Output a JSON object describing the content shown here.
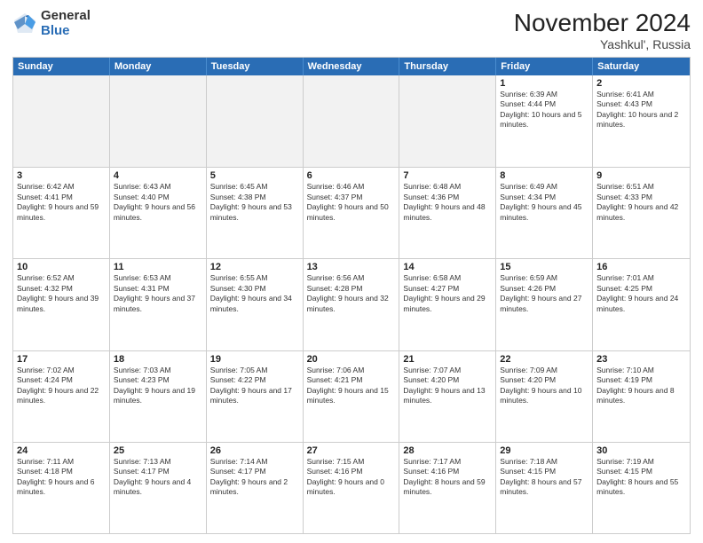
{
  "logo": {
    "general": "General",
    "blue": "Blue"
  },
  "title": {
    "month": "November 2024",
    "location": "Yashkul', Russia"
  },
  "header_days": [
    "Sunday",
    "Monday",
    "Tuesday",
    "Wednesday",
    "Thursday",
    "Friday",
    "Saturday"
  ],
  "weeks": [
    [
      {
        "day": "",
        "info": ""
      },
      {
        "day": "",
        "info": ""
      },
      {
        "day": "",
        "info": ""
      },
      {
        "day": "",
        "info": ""
      },
      {
        "day": "",
        "info": ""
      },
      {
        "day": "1",
        "info": "Sunrise: 6:39 AM\nSunset: 4:44 PM\nDaylight: 10 hours and 5 minutes."
      },
      {
        "day": "2",
        "info": "Sunrise: 6:41 AM\nSunset: 4:43 PM\nDaylight: 10 hours and 2 minutes."
      }
    ],
    [
      {
        "day": "3",
        "info": "Sunrise: 6:42 AM\nSunset: 4:41 PM\nDaylight: 9 hours and 59 minutes."
      },
      {
        "day": "4",
        "info": "Sunrise: 6:43 AM\nSunset: 4:40 PM\nDaylight: 9 hours and 56 minutes."
      },
      {
        "day": "5",
        "info": "Sunrise: 6:45 AM\nSunset: 4:38 PM\nDaylight: 9 hours and 53 minutes."
      },
      {
        "day": "6",
        "info": "Sunrise: 6:46 AM\nSunset: 4:37 PM\nDaylight: 9 hours and 50 minutes."
      },
      {
        "day": "7",
        "info": "Sunrise: 6:48 AM\nSunset: 4:36 PM\nDaylight: 9 hours and 48 minutes."
      },
      {
        "day": "8",
        "info": "Sunrise: 6:49 AM\nSunset: 4:34 PM\nDaylight: 9 hours and 45 minutes."
      },
      {
        "day": "9",
        "info": "Sunrise: 6:51 AM\nSunset: 4:33 PM\nDaylight: 9 hours and 42 minutes."
      }
    ],
    [
      {
        "day": "10",
        "info": "Sunrise: 6:52 AM\nSunset: 4:32 PM\nDaylight: 9 hours and 39 minutes."
      },
      {
        "day": "11",
        "info": "Sunrise: 6:53 AM\nSunset: 4:31 PM\nDaylight: 9 hours and 37 minutes."
      },
      {
        "day": "12",
        "info": "Sunrise: 6:55 AM\nSunset: 4:30 PM\nDaylight: 9 hours and 34 minutes."
      },
      {
        "day": "13",
        "info": "Sunrise: 6:56 AM\nSunset: 4:28 PM\nDaylight: 9 hours and 32 minutes."
      },
      {
        "day": "14",
        "info": "Sunrise: 6:58 AM\nSunset: 4:27 PM\nDaylight: 9 hours and 29 minutes."
      },
      {
        "day": "15",
        "info": "Sunrise: 6:59 AM\nSunset: 4:26 PM\nDaylight: 9 hours and 27 minutes."
      },
      {
        "day": "16",
        "info": "Sunrise: 7:01 AM\nSunset: 4:25 PM\nDaylight: 9 hours and 24 minutes."
      }
    ],
    [
      {
        "day": "17",
        "info": "Sunrise: 7:02 AM\nSunset: 4:24 PM\nDaylight: 9 hours and 22 minutes."
      },
      {
        "day": "18",
        "info": "Sunrise: 7:03 AM\nSunset: 4:23 PM\nDaylight: 9 hours and 19 minutes."
      },
      {
        "day": "19",
        "info": "Sunrise: 7:05 AM\nSunset: 4:22 PM\nDaylight: 9 hours and 17 minutes."
      },
      {
        "day": "20",
        "info": "Sunrise: 7:06 AM\nSunset: 4:21 PM\nDaylight: 9 hours and 15 minutes."
      },
      {
        "day": "21",
        "info": "Sunrise: 7:07 AM\nSunset: 4:20 PM\nDaylight: 9 hours and 13 minutes."
      },
      {
        "day": "22",
        "info": "Sunrise: 7:09 AM\nSunset: 4:20 PM\nDaylight: 9 hours and 10 minutes."
      },
      {
        "day": "23",
        "info": "Sunrise: 7:10 AM\nSunset: 4:19 PM\nDaylight: 9 hours and 8 minutes."
      }
    ],
    [
      {
        "day": "24",
        "info": "Sunrise: 7:11 AM\nSunset: 4:18 PM\nDaylight: 9 hours and 6 minutes."
      },
      {
        "day": "25",
        "info": "Sunrise: 7:13 AM\nSunset: 4:17 PM\nDaylight: 9 hours and 4 minutes."
      },
      {
        "day": "26",
        "info": "Sunrise: 7:14 AM\nSunset: 4:17 PM\nDaylight: 9 hours and 2 minutes."
      },
      {
        "day": "27",
        "info": "Sunrise: 7:15 AM\nSunset: 4:16 PM\nDaylight: 9 hours and 0 minutes."
      },
      {
        "day": "28",
        "info": "Sunrise: 7:17 AM\nSunset: 4:16 PM\nDaylight: 8 hours and 59 minutes."
      },
      {
        "day": "29",
        "info": "Sunrise: 7:18 AM\nSunset: 4:15 PM\nDaylight: 8 hours and 57 minutes."
      },
      {
        "day": "30",
        "info": "Sunrise: 7:19 AM\nSunset: 4:15 PM\nDaylight: 8 hours and 55 minutes."
      }
    ]
  ]
}
